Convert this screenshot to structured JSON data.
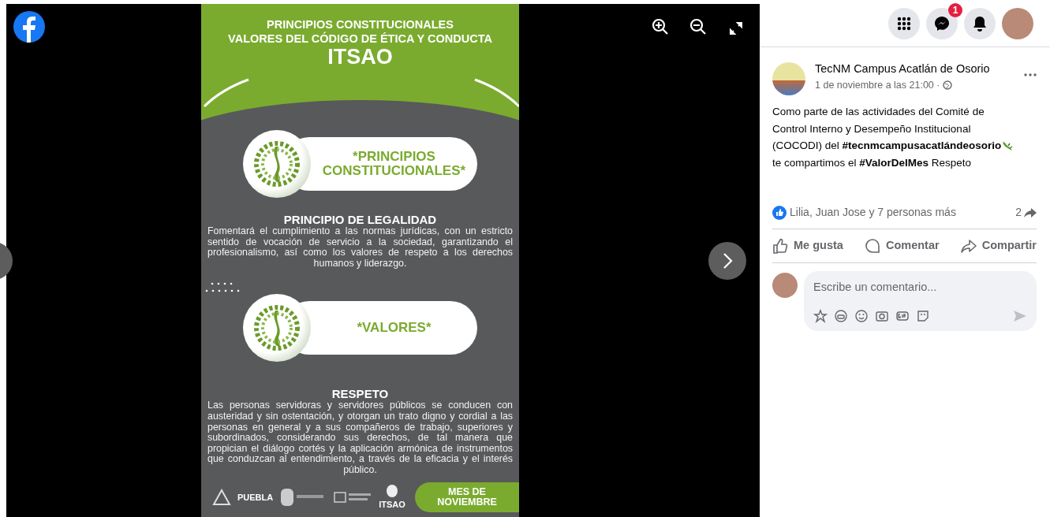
{
  "poster": {
    "heading_lines": [
      "PRINCIPIOS CONSTITUCIONALES",
      "VALORES DEL CÓDIGO DE ÉTICA Y CONDUCTA"
    ],
    "brand": "ITSAO",
    "sections": [
      {
        "pill": "*PRINCIPIOS CONSTITUCIONALES*",
        "title": "PRINCIPIO DE LEGALIDAD",
        "body": "Fomentará el cumplimiento a las normas jurídicas, con un estricto sentido de vocación de servicio a la sociedad, garantizando el profesionalismo, así como los valores de respeto a los derechos humanos y liderazgo."
      },
      {
        "pill": "*VALORES*",
        "title": "RESPETO",
        "body": "Las personas servidoras y servidores públicos se conducen con austeridad y sin ostentación, y otorgan un trato digno y cordial a las personas en general y a sus compañeros de trabajo, superiores y subordinados, considerando sus derechos, de tal manera que propician el diálogo cortés y la aplicación armónica de instrumentos que conduzcan al entendimiento, a través de la eficacia y el interés público."
      }
    ],
    "footer_logos": [
      "PUEBLA",
      "ITSAO"
    ],
    "month_badge": "MES DE NOVIEMBRE"
  },
  "topbar": {
    "messenger_badge": "1"
  },
  "post": {
    "author": "TecNM Campus Acatlán de Osorio",
    "timestamp": "1 de noviembre a las 21:00 ·",
    "text_lines": [
      {
        "text": "Como parte de las actividades del Comité de",
        "emoji": false
      },
      {
        "text": "Control Interno y Desempeño Institucional",
        "emoji": false
      },
      {
        "text": "(COCODI) del **#tecnmcampusacatlándeosorio**",
        "emoji": true
      },
      {
        "text": "te compartimos el **#ValorDelMes** Respeto",
        "emoji": false
      }
    ],
    "reactions": "Lilia, Juan Jose y 7 personas más",
    "shares": "2",
    "actions": [
      {
        "kind": "like",
        "label": "Me gusta"
      },
      {
        "kind": "comment",
        "label": "Comentar"
      },
      {
        "kind": "share",
        "label": "Compartir"
      }
    ],
    "comment_placeholder": "Escribe un comentario..."
  }
}
